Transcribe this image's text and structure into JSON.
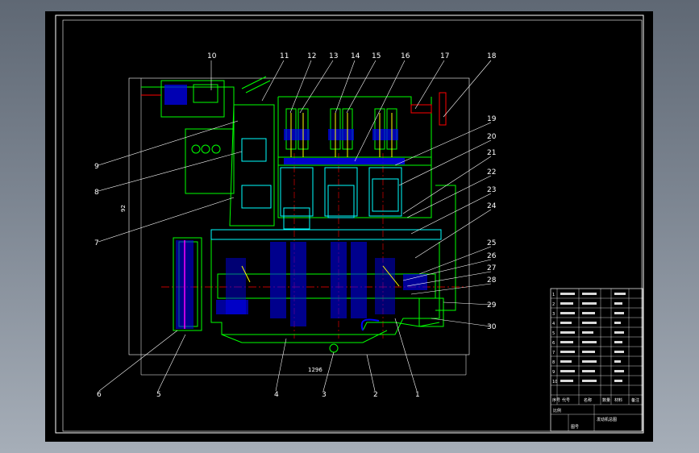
{
  "drawing": {
    "part_numbers": [
      "1",
      "2",
      "3",
      "4",
      "5",
      "6",
      "7",
      "8",
      "9",
      "10",
      "11",
      "12",
      "13",
      "14",
      "15",
      "16",
      "17",
      "18",
      "19",
      "20",
      "21",
      "22",
      "23",
      "24",
      "25",
      "26",
      "27",
      "28",
      "29",
      "30"
    ],
    "dimensions": {
      "width": "1296",
      "height": "92"
    }
  },
  "title_block": {
    "rows": [
      [
        "1",
        "",
        "",
        "",
        "",
        ""
      ],
      [
        "2",
        "",
        "",
        "",
        "",
        ""
      ],
      [
        "3",
        "",
        "",
        "",
        "",
        ""
      ],
      [
        "4",
        "",
        "",
        "",
        "",
        ""
      ],
      [
        "5",
        "",
        "",
        "",
        "",
        ""
      ],
      [
        "6",
        "",
        "",
        "",
        "",
        ""
      ],
      [
        "7",
        "",
        "",
        "",
        "",
        ""
      ],
      [
        "8",
        "",
        "",
        "",
        "",
        ""
      ],
      [
        "9",
        "",
        "",
        "",
        "",
        ""
      ],
      [
        "10",
        "",
        "",
        "",
        "",
        ""
      ]
    ],
    "footer": [
      "序号",
      "代号",
      "名称",
      "数量",
      "材料",
      "备注"
    ],
    "bottom_labels": [
      "发动机总图",
      "比例",
      "图号"
    ]
  },
  "colors": {
    "background": "#000000",
    "frame": "#ffffff",
    "outline": "#00ff00",
    "cyan": "#00ffff",
    "blue": "#0000ff",
    "red": "#ff0000",
    "yellow": "#ffff00",
    "magenta": "#ff00ff"
  }
}
